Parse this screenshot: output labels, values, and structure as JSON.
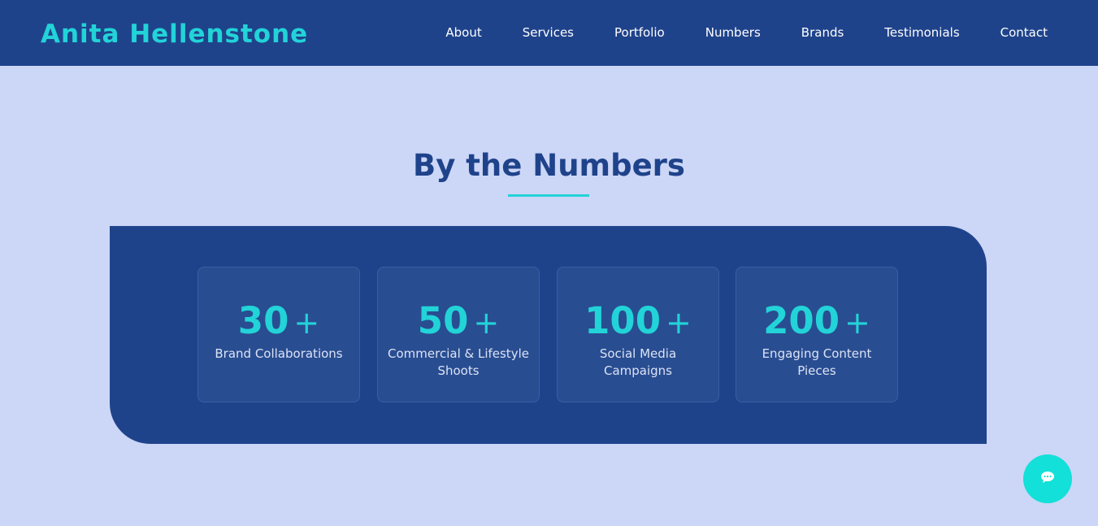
{
  "header": {
    "logo": "Anita Hellenstone",
    "nav": [
      "About",
      "Services",
      "Portfolio",
      "Numbers",
      "Brands",
      "Testimonials",
      "Contact"
    ]
  },
  "numbers_section": {
    "title": "By the Numbers",
    "stats": [
      {
        "value": "30",
        "suffix": "+",
        "label": "Brand Collaborations"
      },
      {
        "value": "50",
        "suffix": "+",
        "label": "Commercial & Lifestyle Shoots"
      },
      {
        "value": "100",
        "suffix": "+",
        "label": "Social Media Campaigns"
      },
      {
        "value": "200",
        "suffix": "+",
        "label": "Engaging Content Pieces"
      }
    ]
  },
  "chat": {
    "icon": "chat-bubble-icon"
  },
  "colors": {
    "header_bg": "#1f438b",
    "accent": "#22d3d8",
    "page_bg": "#ccd6f6",
    "card_bg": "#294d91",
    "chat_button": "#13e0d8"
  }
}
